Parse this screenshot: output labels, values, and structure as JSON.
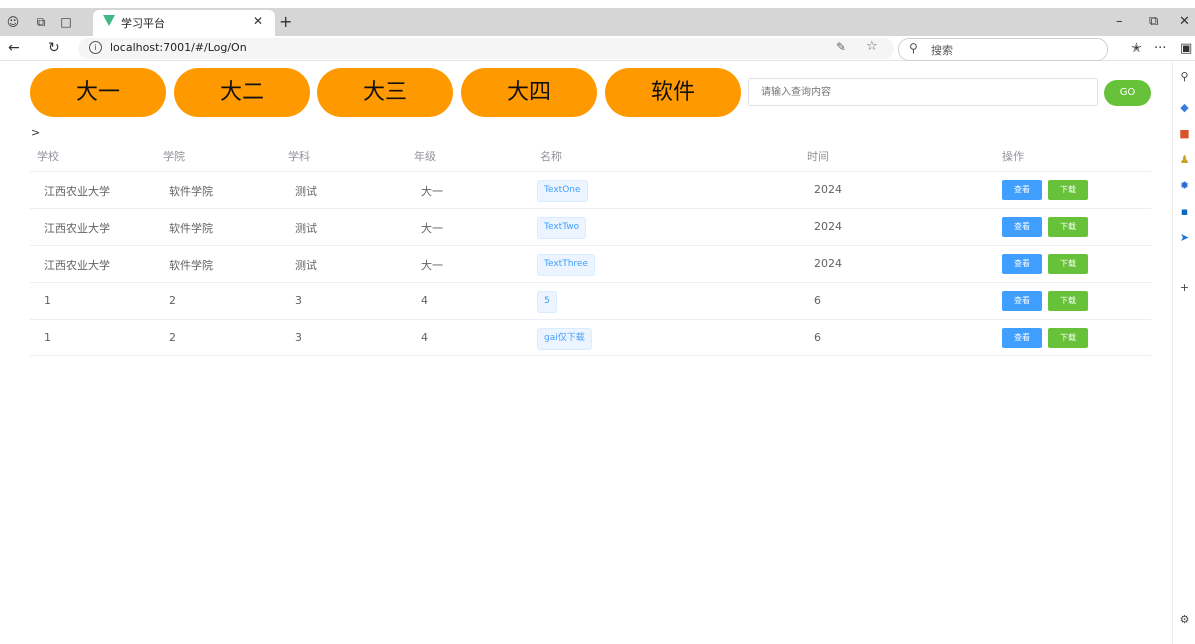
{
  "browser": {
    "tab_title": "学习平台",
    "url": "localhost:7001/#/Log/On",
    "search_placeholder": "搜索"
  },
  "categories": [
    "大一",
    "大二",
    "大三",
    "大四",
    "软件"
  ],
  "search": {
    "placeholder": "请输入查询内容",
    "go_label": "GO"
  },
  "breadcrumb": ">",
  "table": {
    "headers": [
      "学校",
      "学院",
      "学科",
      "年级",
      "名称",
      "时间",
      "操作"
    ],
    "rows": [
      {
        "school": "江西农业大学",
        "college": "软件学院",
        "subject": "测试",
        "grade": "大一",
        "name": "TextOne",
        "time": "2024"
      },
      {
        "school": "江西农业大学",
        "college": "软件学院",
        "subject": "测试",
        "grade": "大一",
        "name": "TextTwo",
        "time": "2024"
      },
      {
        "school": "江西农业大学",
        "college": "软件学院",
        "subject": "测试",
        "grade": "大一",
        "name": "TextThree",
        "time": "2024"
      },
      {
        "school": "1",
        "college": "2",
        "subject": "3",
        "grade": "4",
        "name": "5",
        "time": "6"
      },
      {
        "school": "1",
        "college": "2",
        "subject": "3",
        "grade": "4",
        "name": "gai仅下载",
        "time": "6"
      }
    ],
    "view_label": "查看",
    "download_label": "下载"
  },
  "colors": {
    "pill": "#ff9900",
    "go": "#67c23a",
    "view": "#409eff",
    "download": "#67c23a"
  }
}
